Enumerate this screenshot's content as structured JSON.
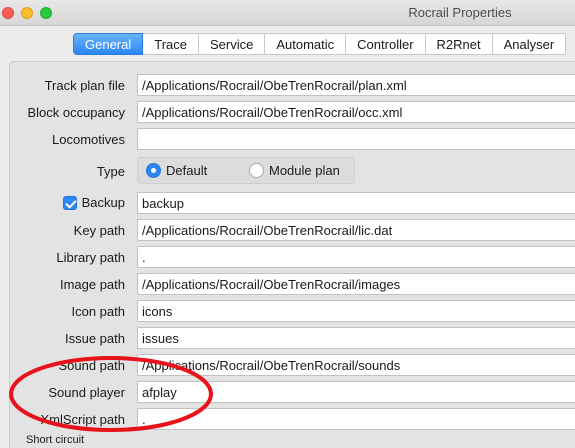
{
  "window": {
    "title": "Rocrail Properties"
  },
  "tabs": [
    "General",
    "Trace",
    "Service",
    "Automatic",
    "Controller",
    "R2Rnet",
    "Analyser"
  ],
  "fields": {
    "track_plan_file": {
      "label": "Track plan file",
      "value": "/Applications/Rocrail/ObeTrenRocrail/plan.xml"
    },
    "block_occupancy": {
      "label": "Block occupancy",
      "value": "/Applications/Rocrail/ObeTrenRocrail/occ.xml"
    },
    "locomotives": {
      "label": "Locomotives",
      "value": ""
    },
    "type": {
      "label": "Type",
      "options": [
        "Default",
        "Module plan"
      ],
      "selected": "Default"
    },
    "backup": {
      "label": "Backup",
      "checked": true,
      "value": "backup"
    },
    "key_path": {
      "label": "Key path",
      "value": "/Applications/Rocrail/ObeTrenRocrail/lic.dat"
    },
    "library_path": {
      "label": "Library path",
      "value": "."
    },
    "image_path": {
      "label": "Image path",
      "value": "/Applications/Rocrail/ObeTrenRocrail/images"
    },
    "icon_path": {
      "label": "Icon path",
      "value": "icons"
    },
    "issue_path": {
      "label": "Issue path",
      "value": "issues"
    },
    "sound_path": {
      "label": "Sound path",
      "value": "/Applications/Rocrail/ObeTrenRocrail/sounds"
    },
    "sound_player": {
      "label": "Sound player",
      "value": "afplay"
    },
    "xmlscript_path": {
      "label": "XmlScript path",
      "value": "."
    }
  },
  "section": {
    "short_circuit": "Short circuit"
  },
  "colors": {
    "accent": "#2a87f5",
    "annotation": "#e8121a"
  }
}
